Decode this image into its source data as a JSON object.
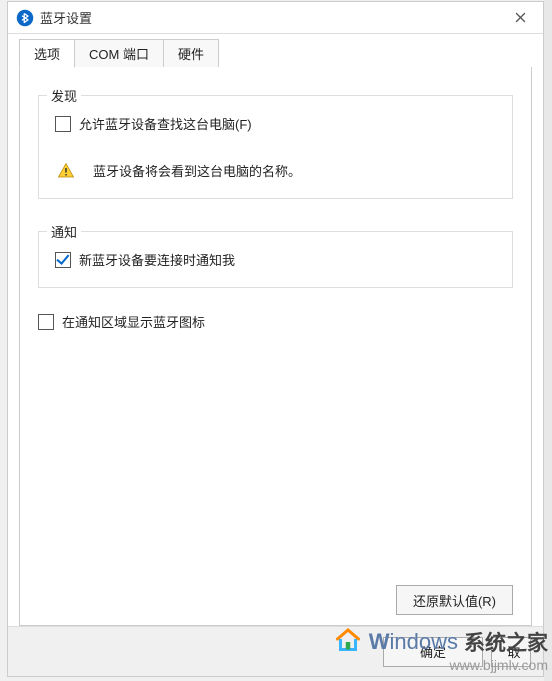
{
  "dialog": {
    "title": "蓝牙设置"
  },
  "tabs": {
    "options": "选项",
    "com_ports": "COM 端口",
    "hardware": "硬件"
  },
  "discovery": {
    "legend": "发现",
    "allow_find_label": "允许蓝牙设备查找这台电脑(F)",
    "allow_find_checked": false,
    "warning_text": "蓝牙设备将会看到这台电脑的名称。"
  },
  "notifications": {
    "legend": "通知",
    "notify_new_label": "新蓝牙设备要连接时通知我",
    "notify_new_checked": true
  },
  "show_icon": {
    "label": "在通知区域显示蓝牙图标",
    "checked": false
  },
  "buttons": {
    "restore_defaults": "还原默认值(R)",
    "ok": "确定",
    "cancel_partial": "取"
  },
  "watermark": {
    "brand_en": "Windows",
    "brand_cn": "系统之家",
    "url": "www.bjjmlv.com"
  }
}
